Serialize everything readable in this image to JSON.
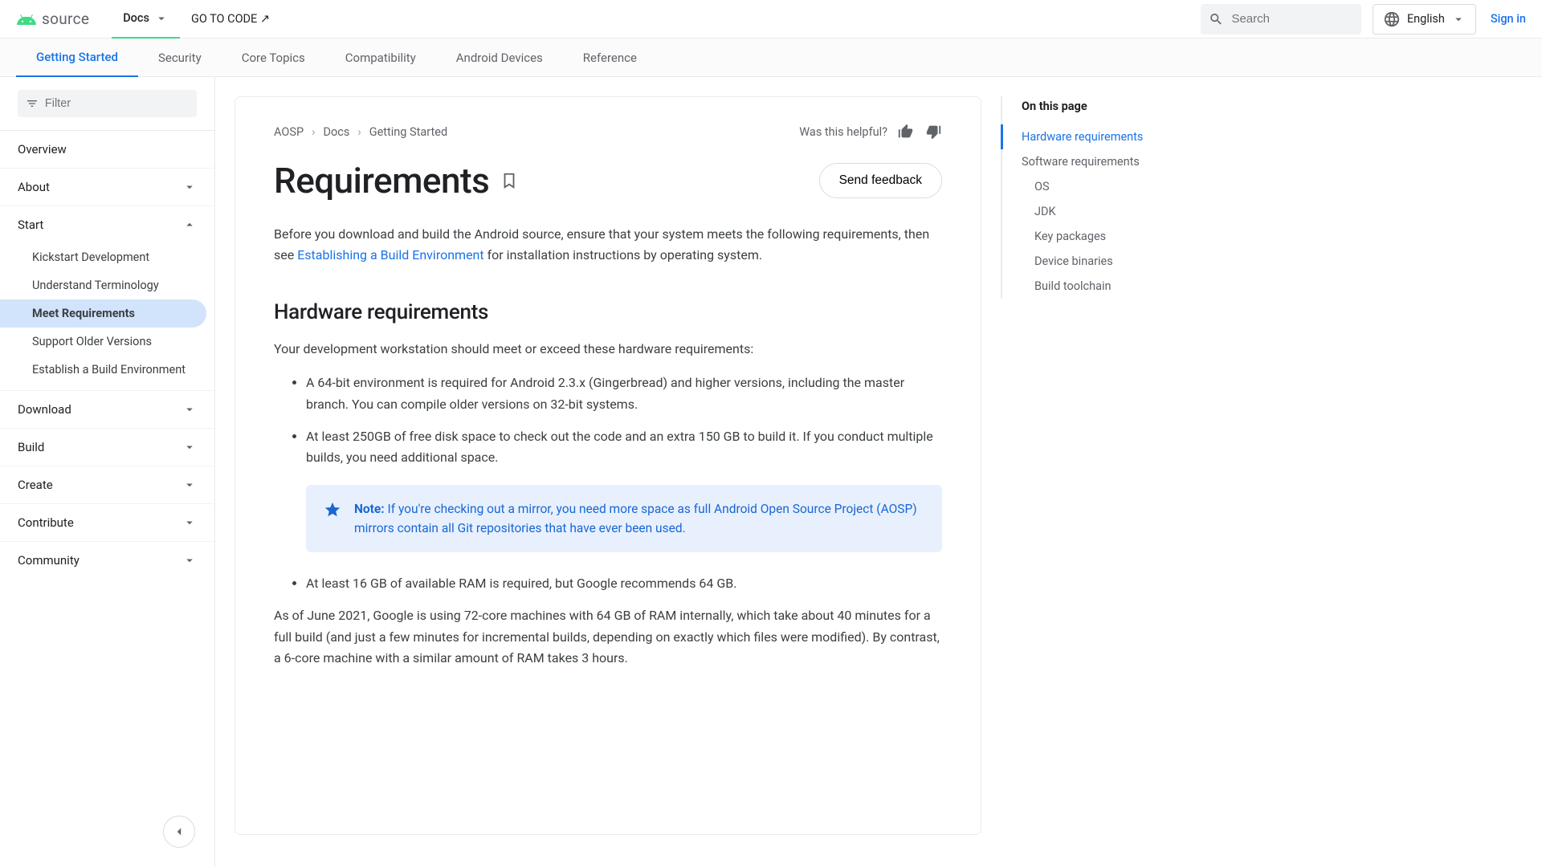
{
  "header": {
    "brand": "source",
    "nav": {
      "docs": "Docs",
      "code": "GO TO CODE ↗"
    },
    "search_placeholder": "Search",
    "lang": "English",
    "signin": "Sign in"
  },
  "tabs": {
    "getting_started": "Getting Started",
    "security": "Security",
    "core_topics": "Core Topics",
    "compatibility": "Compatibility",
    "android_devices": "Android Devices",
    "reference": "Reference"
  },
  "sidebar": {
    "filter_placeholder": "Filter",
    "overview": "Overview",
    "about": "About",
    "start": "Start",
    "start_children": {
      "kickstart": "Kickstart Development",
      "terminology": "Understand Terminology",
      "requirements": "Meet Requirements",
      "older": "Support Older Versions",
      "env": "Establish a Build Environment"
    },
    "download": "Download",
    "build": "Build",
    "create": "Create",
    "contribute": "Contribute",
    "community": "Community"
  },
  "breadcrumbs": {
    "a": "AOSP",
    "b": "Docs",
    "c": "Getting Started"
  },
  "helpful": {
    "label": "Was this helpful?"
  },
  "page": {
    "title": "Requirements",
    "feedback_btn": "Send feedback",
    "intro_before": "Before you download and build the Android source, ensure that your system meets the following requirements, then see ",
    "intro_link": "Establishing a Build Environment",
    "intro_after": " for installation instructions by operating system.",
    "h_hardware": "Hardware requirements",
    "hw_lead": "Your development workstation should meet or exceed these hardware requirements:",
    "hw_li1": "A 64-bit environment is required for Android 2.3.x (Gingerbread) and higher versions, including the master branch. You can compile older versions on 32-bit systems.",
    "hw_li2": "At least 250GB of free disk space to check out the code and an extra 150 GB to build it. If you conduct multiple builds, you need additional space.",
    "note_label": "Note:",
    "note_body": " If you're checking out a mirror, you need more space as full Android Open Source Project (AOSP) mirrors contain all Git repositories that have ever been used.",
    "hw_li3": "At least 16 GB of available RAM is required, but Google recommends 64 GB.",
    "para2": "As of June 2021, Google is using 72-core machines with 64 GB of RAM internally, which take about 40 minutes for a full build (and just a few minutes for incremental builds, depending on exactly which files were modified). By contrast, a 6-core machine with a similar amount of RAM takes 3 hours."
  },
  "toc": {
    "title": "On this page",
    "hardware": "Hardware requirements",
    "software": "Software requirements",
    "os": "OS",
    "jdk": "JDK",
    "packages": "Key packages",
    "binaries": "Device binaries",
    "toolchain": "Build toolchain"
  }
}
